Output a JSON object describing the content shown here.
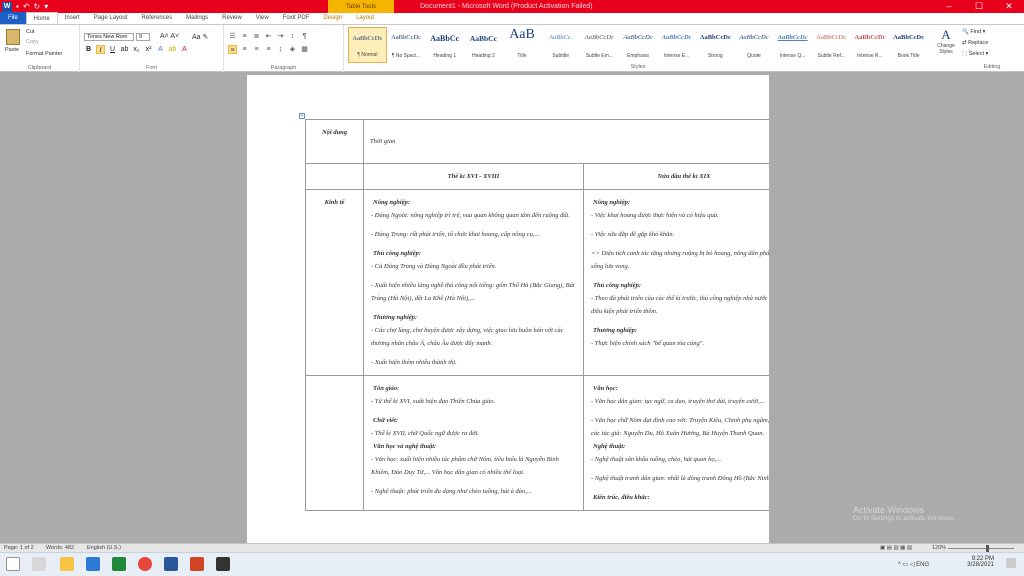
{
  "titlebar": {
    "title": "Document1 - Microsoft Word (Product Activation Failed)",
    "table_tools": "Table Tools",
    "minimize": "–",
    "maximize": "☐",
    "close": "✕"
  },
  "tabs": [
    "File",
    "Home",
    "Insert",
    "Page Layout",
    "References",
    "Mailings",
    "Review",
    "View",
    "Foxit PDF",
    "Design",
    "Layout"
  ],
  "ribbon": {
    "clipboard": {
      "label": "Clipboard",
      "paste": "Paste",
      "cut": "Cut",
      "copy": "Copy",
      "format_painter": "Format Painter"
    },
    "font": {
      "label": "Font",
      "name": "Times New Rom",
      "size": "9"
    },
    "paragraph": {
      "label": "Paragraph"
    },
    "styles": {
      "label": "Styles",
      "items": [
        {
          "sample": "AaBbCcDc",
          "name": "¶ Normal"
        },
        {
          "sample": "AaBbCcDc",
          "name": "¶ No Spaci..."
        },
        {
          "sample": "AaBbCc",
          "name": "Heading 1"
        },
        {
          "sample": "AaBbCc",
          "name": "Heading 2"
        },
        {
          "sample": "AaB",
          "name": "Title"
        },
        {
          "sample": "AaBbCc.",
          "name": "Subtitle"
        },
        {
          "sample": "AaBbCcDc",
          "name": "Subtle Em..."
        },
        {
          "sample": "AaBbCcDc",
          "name": "Emphasis"
        },
        {
          "sample": "AaBbCcDc",
          "name": "Intense E..."
        },
        {
          "sample": "AaBbCcDc",
          "name": "Strong"
        },
        {
          "sample": "AaBbCcDc",
          "name": "Quote"
        },
        {
          "sample": "AaBbCcDc",
          "name": "Intense Q..."
        },
        {
          "sample": "AaBbCcDc",
          "name": "Subtle Ref..."
        },
        {
          "sample": "AaBbCcDc",
          "name": "Intense R..."
        },
        {
          "sample": "AaBbCcDc",
          "name": "Book Title"
        }
      ],
      "change_styles": "Change Styles"
    },
    "editing": {
      "label": "Editing",
      "find": "Find",
      "replace": "Replace",
      "select": "Select"
    }
  },
  "table": {
    "r0": {
      "c0": "Nội dung",
      "c1": "Thời gian"
    },
    "r1": {
      "c1": "Thế kỉ XVI - XVIII",
      "c2": "Nửa đầu thế kỉ XIX"
    },
    "kinh_te": {
      "label": "Kinh tế",
      "left": {
        "nn_title": "Nông nghiệp:",
        "nn_1": "- Đàng Ngoài: nông nghiệp trì trệ, vua quan không quan tâm đến ruộng đất.",
        "nn_2": "- Đàng Trong: rất phát triển, tổ chức khai hoang, cấp nông cụ,...",
        "tcn_title": "Thủ công nghiệp:",
        "tcn_1": "- Cả Đàng Trong và Đàng Ngoài đều phát triển.",
        "tcn_2": "- Xuất hiện nhiều làng nghề thủ công nổi tiếng: gốm Thổ Hà (Bắc Giang), Bát Tràng (Hà Nội), dệt La Khê (Hà Nội),...",
        "tn_title": "Thương nghiệp:",
        "tn_1": "- Các chợ làng, chợ huyện được xây dựng, việc giao lưu buôn bán với các thương nhân châu Á, châu Âu được đẩy mạnh.",
        "tn_2": "- Xuất hiện thêm nhiều thành thị."
      },
      "right": {
        "nn_title": "Nông nghiệp:",
        "nn_1": "- Việc khai hoang được thực hiện và có hiệu quả.",
        "nn_2": "- Việc sửa đắp đê gặp khó khăn.",
        "nn_3": "=> Diện tích canh tác tăng nhưng ruộng bị bỏ hoang, nông dân phải sống lưu vong.",
        "tcn_title": "Thủ công nghiệp:",
        "tcn_1": "- Theo đà phát triển của các thế kỉ trước, thủ công nghiệp nhà nước có điều kiện phát triển thêm.",
        "tn_title": "Thương nghiệp:",
        "tn_1": "- Thực hiện chính sách \"bế quan tỏa cảng\"."
      }
    },
    "van_hoa": {
      "left": {
        "tg_title": "Tôn giáo:",
        "tg_1": "- Từ thế kỉ XVI, xuất hiện đạo Thiên Chúa giáo.",
        "cv_title": "Chữ viết:",
        "cv_1": "- Thế kỉ XVII, chữ Quốc ngữ được ra đời.",
        "vh_title": "Văn học và nghệ thuật:",
        "vh_1": "- Văn học: xuất hiện nhiều tác phẩm chữ Nôm, tiêu biểu là Nguyễn Bỉnh Khiêm, Đào Duy Từ,... Văn học dân gian có nhiều thể loại.",
        "vh_2": "- Nghệ thuật: phát triển đa dạng như chèo tuồng, hát ả đào,..."
      },
      "right": {
        "vh_title": "Văn học:",
        "vh_1": "- Văn học dân gian: tục ngữ, ca dao, truyện thơ dài, truyện cười,...",
        "vh_2": "- Văn học chữ Nôm đạt đỉnh cao với: Truyện Kiều, Chinh phụ ngâm,... các tác giả: Nguyễn Du, Hồ Xuân Hương, Bà Huyện Thanh Quan.",
        "nt_title": "Nghệ thuật:",
        "nt_1": "- Nghệ thuật sân khấu tuồng, chèo, hát quan họ,...",
        "nt_2": "- Nghệ thuật tranh dân gian: nhất là dòng tranh Đông Hồ (Bắc Ninh).",
        "kt_title": "Kiến trúc, điêu khắc:"
      }
    }
  },
  "status": {
    "page": "Page: 1 of 2",
    "words": "Words: 482",
    "language": "English (U.S.)",
    "zoom": "120%"
  },
  "watermark": {
    "title": "Activate Windows",
    "subtitle": "Go to Settings to activate Windows."
  },
  "taskbar": {
    "lang": "ENG",
    "time": "9:22 PM",
    "date": "3/28/2021"
  }
}
